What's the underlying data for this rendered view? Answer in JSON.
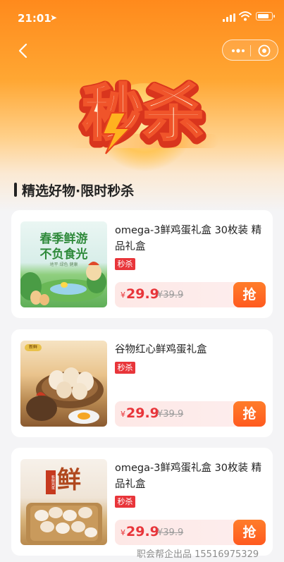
{
  "status_bar": {
    "time": "21:01"
  },
  "hero": {
    "title": "秒杀"
  },
  "section": {
    "title": "精选好物·限时秒杀"
  },
  "products": [
    {
      "name": "omega-3鲜鸡蛋礼盒 30枚装 精品礼盒",
      "tag": "秒杀",
      "currency": "¥",
      "price": "29.9",
      "original_price": "¥39.9",
      "buy_label": "抢",
      "image_text": {
        "line1": "春季鲜游",
        "line2": "不负食光",
        "small": "地平  绿色  健康"
      }
    },
    {
      "name": "谷物红心鲜鸡蛋礼盒",
      "tag": "秒杀",
      "currency": "¥",
      "price": "29.9",
      "original_price": "¥39.9",
      "buy_label": "抢",
      "image_text": {
        "badge": "新鲜"
      }
    },
    {
      "name": "omega-3鲜鸡蛋礼盒 30枚装 精品礼盒",
      "tag": "秒杀",
      "currency": "¥",
      "price": "29.9",
      "original_price": "¥39.9",
      "buy_label": "抢",
      "image_text": {
        "big": "鲜",
        "badge": "新鲜鸡蛋"
      }
    }
  ],
  "watermark": "职会帮企出品 15516975329",
  "colors": {
    "accent": "#ff8a1c",
    "price": "#e8353a",
    "buy": "#ff5a1f",
    "tag": "#e8353a"
  }
}
